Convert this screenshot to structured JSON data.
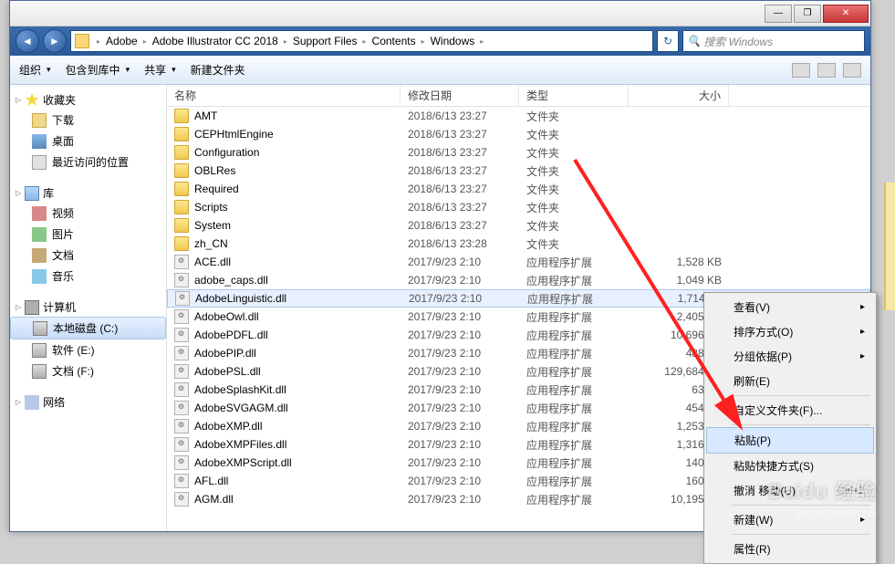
{
  "titlebar": {
    "min": "—",
    "max": "❐",
    "close": "✕"
  },
  "breadcrumb": {
    "items": [
      "Adobe",
      "Adobe Illustrator CC 2018",
      "Support Files",
      "Contents",
      "Windows"
    ]
  },
  "search": {
    "placeholder": "搜索 Windows",
    "icon": "🔍"
  },
  "toolbar": {
    "organize": "组织",
    "include": "包含到库中",
    "share": "共享",
    "newfolder": "新建文件夹"
  },
  "sidebar": {
    "favorites": {
      "label": "收藏夹",
      "items": [
        "下载",
        "桌面",
        "最近访问的位置"
      ]
    },
    "libraries": {
      "label": "库",
      "items": [
        "视频",
        "图片",
        "文档",
        "音乐"
      ]
    },
    "computer": {
      "label": "计算机",
      "items": [
        "本地磁盘 (C:)",
        "软件 (E:)",
        "文档 (F:)"
      ]
    },
    "network": {
      "label": "网络"
    }
  },
  "columns": {
    "name": "名称",
    "date": "修改日期",
    "type": "类型",
    "size": "大小"
  },
  "files": [
    {
      "name": "AMT",
      "date": "2018/6/13 23:27",
      "type": "文件夹",
      "size": "",
      "kind": "folder"
    },
    {
      "name": "CEPHtmlEngine",
      "date": "2018/6/13 23:27",
      "type": "文件夹",
      "size": "",
      "kind": "folder"
    },
    {
      "name": "Configuration",
      "date": "2018/6/13 23:27",
      "type": "文件夹",
      "size": "",
      "kind": "folder"
    },
    {
      "name": "OBLRes",
      "date": "2018/6/13 23:27",
      "type": "文件夹",
      "size": "",
      "kind": "folder"
    },
    {
      "name": "Required",
      "date": "2018/6/13 23:27",
      "type": "文件夹",
      "size": "",
      "kind": "folder"
    },
    {
      "name": "Scripts",
      "date": "2018/6/13 23:27",
      "type": "文件夹",
      "size": "",
      "kind": "folder"
    },
    {
      "name": "System",
      "date": "2018/6/13 23:27",
      "type": "文件夹",
      "size": "",
      "kind": "folder"
    },
    {
      "name": "zh_CN",
      "date": "2018/6/13 23:28",
      "type": "文件夹",
      "size": "",
      "kind": "folder"
    },
    {
      "name": "ACE.dll",
      "date": "2017/9/23 2:10",
      "type": "应用程序扩展",
      "size": "1,528 KB",
      "kind": "dll"
    },
    {
      "name": "adobe_caps.dll",
      "date": "2017/9/23 2:10",
      "type": "应用程序扩展",
      "size": "1,049 KB",
      "kind": "dll"
    },
    {
      "name": "AdobeLinguistic.dll",
      "date": "2017/9/23 2:10",
      "type": "应用程序扩展",
      "size": "1,714 KB",
      "kind": "dll",
      "selected": true
    },
    {
      "name": "AdobeOwl.dll",
      "date": "2017/9/23 2:10",
      "type": "应用程序扩展",
      "size": "2,405 KB",
      "kind": "dll"
    },
    {
      "name": "AdobePDFL.dll",
      "date": "2017/9/23 2:10",
      "type": "应用程序扩展",
      "size": "10,696 KB",
      "kind": "dll"
    },
    {
      "name": "AdobePIP.dll",
      "date": "2017/9/23 2:10",
      "type": "应用程序扩展",
      "size": "488 KB",
      "kind": "dll"
    },
    {
      "name": "AdobePSL.dll",
      "date": "2017/9/23 2:10",
      "type": "应用程序扩展",
      "size": "129,684 KB",
      "kind": "dll"
    },
    {
      "name": "AdobeSplashKit.dll",
      "date": "2017/9/23 2:10",
      "type": "应用程序扩展",
      "size": "63 KB",
      "kind": "dll"
    },
    {
      "name": "AdobeSVGAGM.dll",
      "date": "2017/9/23 2:10",
      "type": "应用程序扩展",
      "size": "454 KB",
      "kind": "dll"
    },
    {
      "name": "AdobeXMP.dll",
      "date": "2017/9/23 2:10",
      "type": "应用程序扩展",
      "size": "1,253 KB",
      "kind": "dll"
    },
    {
      "name": "AdobeXMPFiles.dll",
      "date": "2017/9/23 2:10",
      "type": "应用程序扩展",
      "size": "1,316 KB",
      "kind": "dll"
    },
    {
      "name": "AdobeXMPScript.dll",
      "date": "2017/9/23 2:10",
      "type": "应用程序扩展",
      "size": "140 KB",
      "kind": "dll"
    },
    {
      "name": "AFL.dll",
      "date": "2017/9/23 2:10",
      "type": "应用程序扩展",
      "size": "160 KB",
      "kind": "dll"
    },
    {
      "name": "AGM.dll",
      "date": "2017/9/23 2:10",
      "type": "应用程序扩展",
      "size": "10,195 KB",
      "kind": "dll"
    }
  ],
  "contextmenu": {
    "view": "查看(V)",
    "sort": "排序方式(O)",
    "group": "分组依据(P)",
    "refresh": "刷新(E)",
    "customize": "自定义文件夹(F)...",
    "paste": "粘贴(P)",
    "paste_shortcut": "粘贴快捷方式(S)",
    "undo": "撤消 移动(U)",
    "undo_key": "Ctrl+Z",
    "new": "新建(W)",
    "properties": "属性(R)"
  },
  "watermark": {
    "brand": "Baidu 经验",
    "url": "jingyan.baidu.com"
  }
}
